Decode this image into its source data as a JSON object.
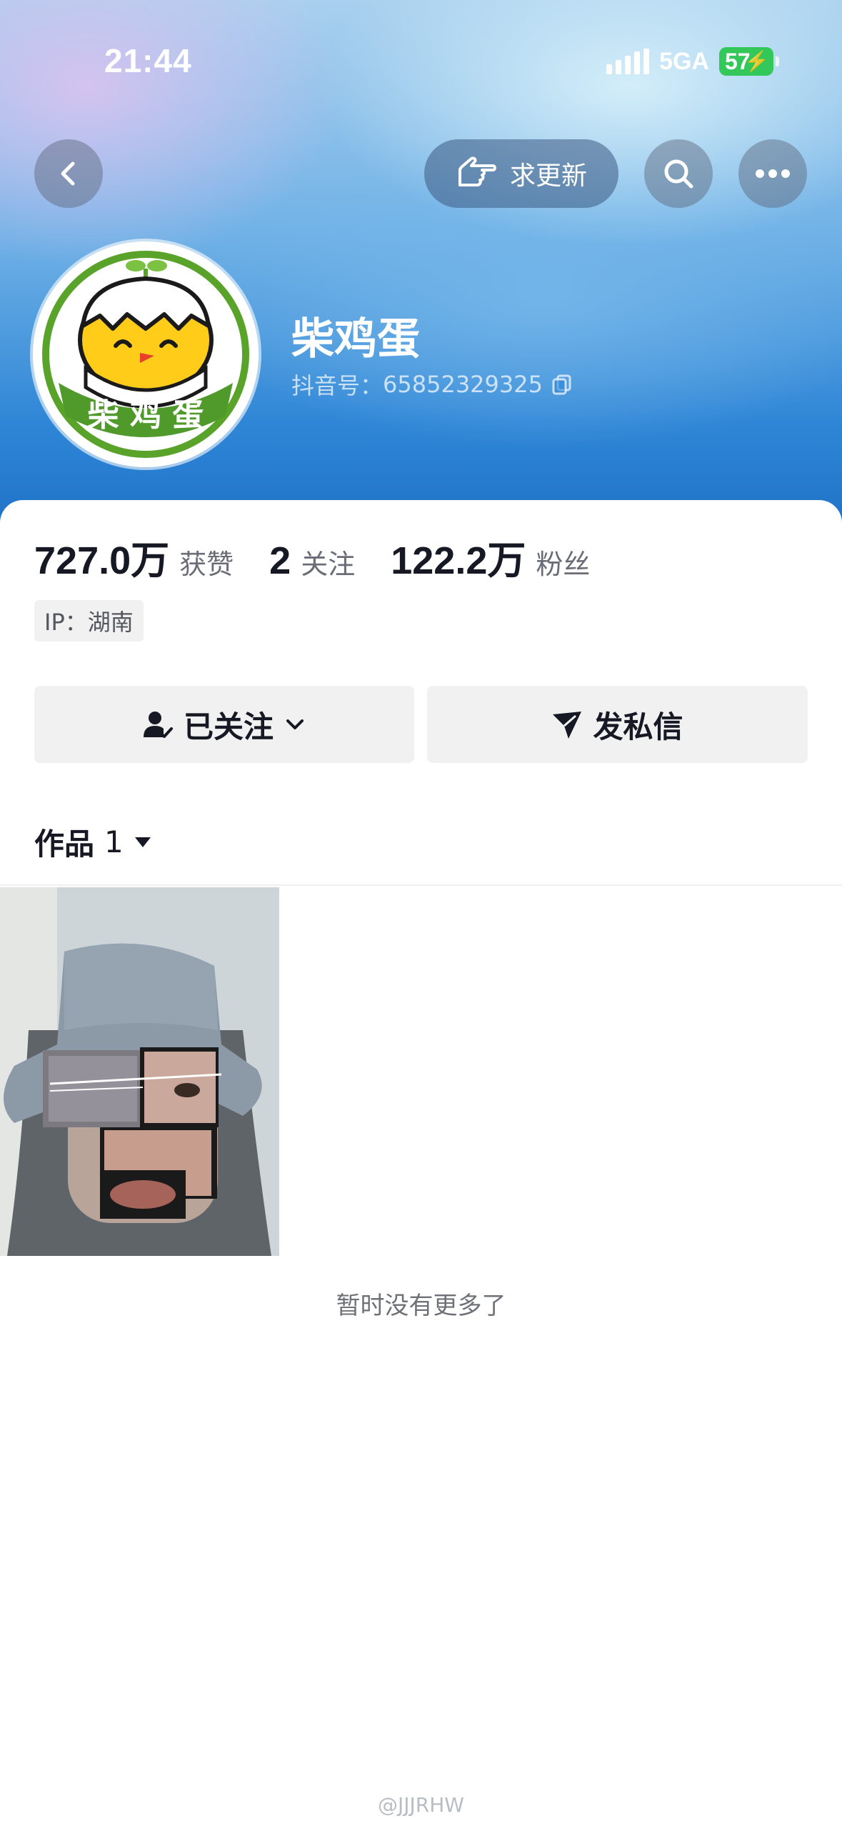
{
  "status_bar": {
    "time": "21:44",
    "network": "5GA",
    "battery": "57"
  },
  "header": {
    "request_update_label": "求更新",
    "nickname": "柴鸡蛋",
    "douyin_id_label": "抖音号：",
    "douyin_id": "65852329325",
    "avatar_text": "柴 鸡 蛋"
  },
  "stats": [
    {
      "value": "727.0万",
      "label": "获赞"
    },
    {
      "value": "2",
      "label": "关注"
    },
    {
      "value": "122.2万",
      "label": "粉丝"
    }
  ],
  "ip_label": "IP：湖南",
  "actions": {
    "following_label": "已关注",
    "message_label": "发私信"
  },
  "works_tab": {
    "label": "作品",
    "count": "1"
  },
  "no_more_text": "暂时没有更多了",
  "watermark": "@JJJRHW",
  "colors": {
    "header_blue": "#2f86d6",
    "battery_green": "#34c759",
    "sheet_bg": "#ffffff"
  }
}
